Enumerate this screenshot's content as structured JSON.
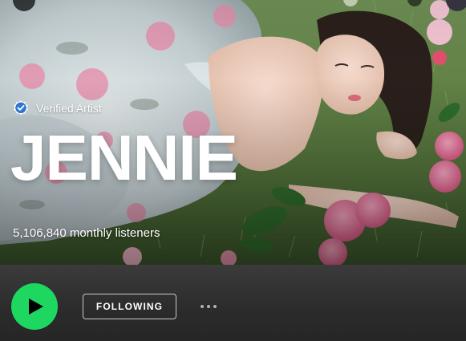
{
  "artist": {
    "verified_label": "Verified Artist",
    "name": "JENNIE",
    "monthly_listeners": "5,106,840 monthly listeners"
  },
  "actions": {
    "follow_label": "FOLLOWING"
  },
  "icons": {
    "verified": "verified-badge-icon",
    "play": "play-icon",
    "more": "more-options-icon"
  },
  "colors": {
    "accent_green": "#1ed760",
    "verified_blue": "#2e77d0",
    "bar_background": "#2b2b2b"
  }
}
